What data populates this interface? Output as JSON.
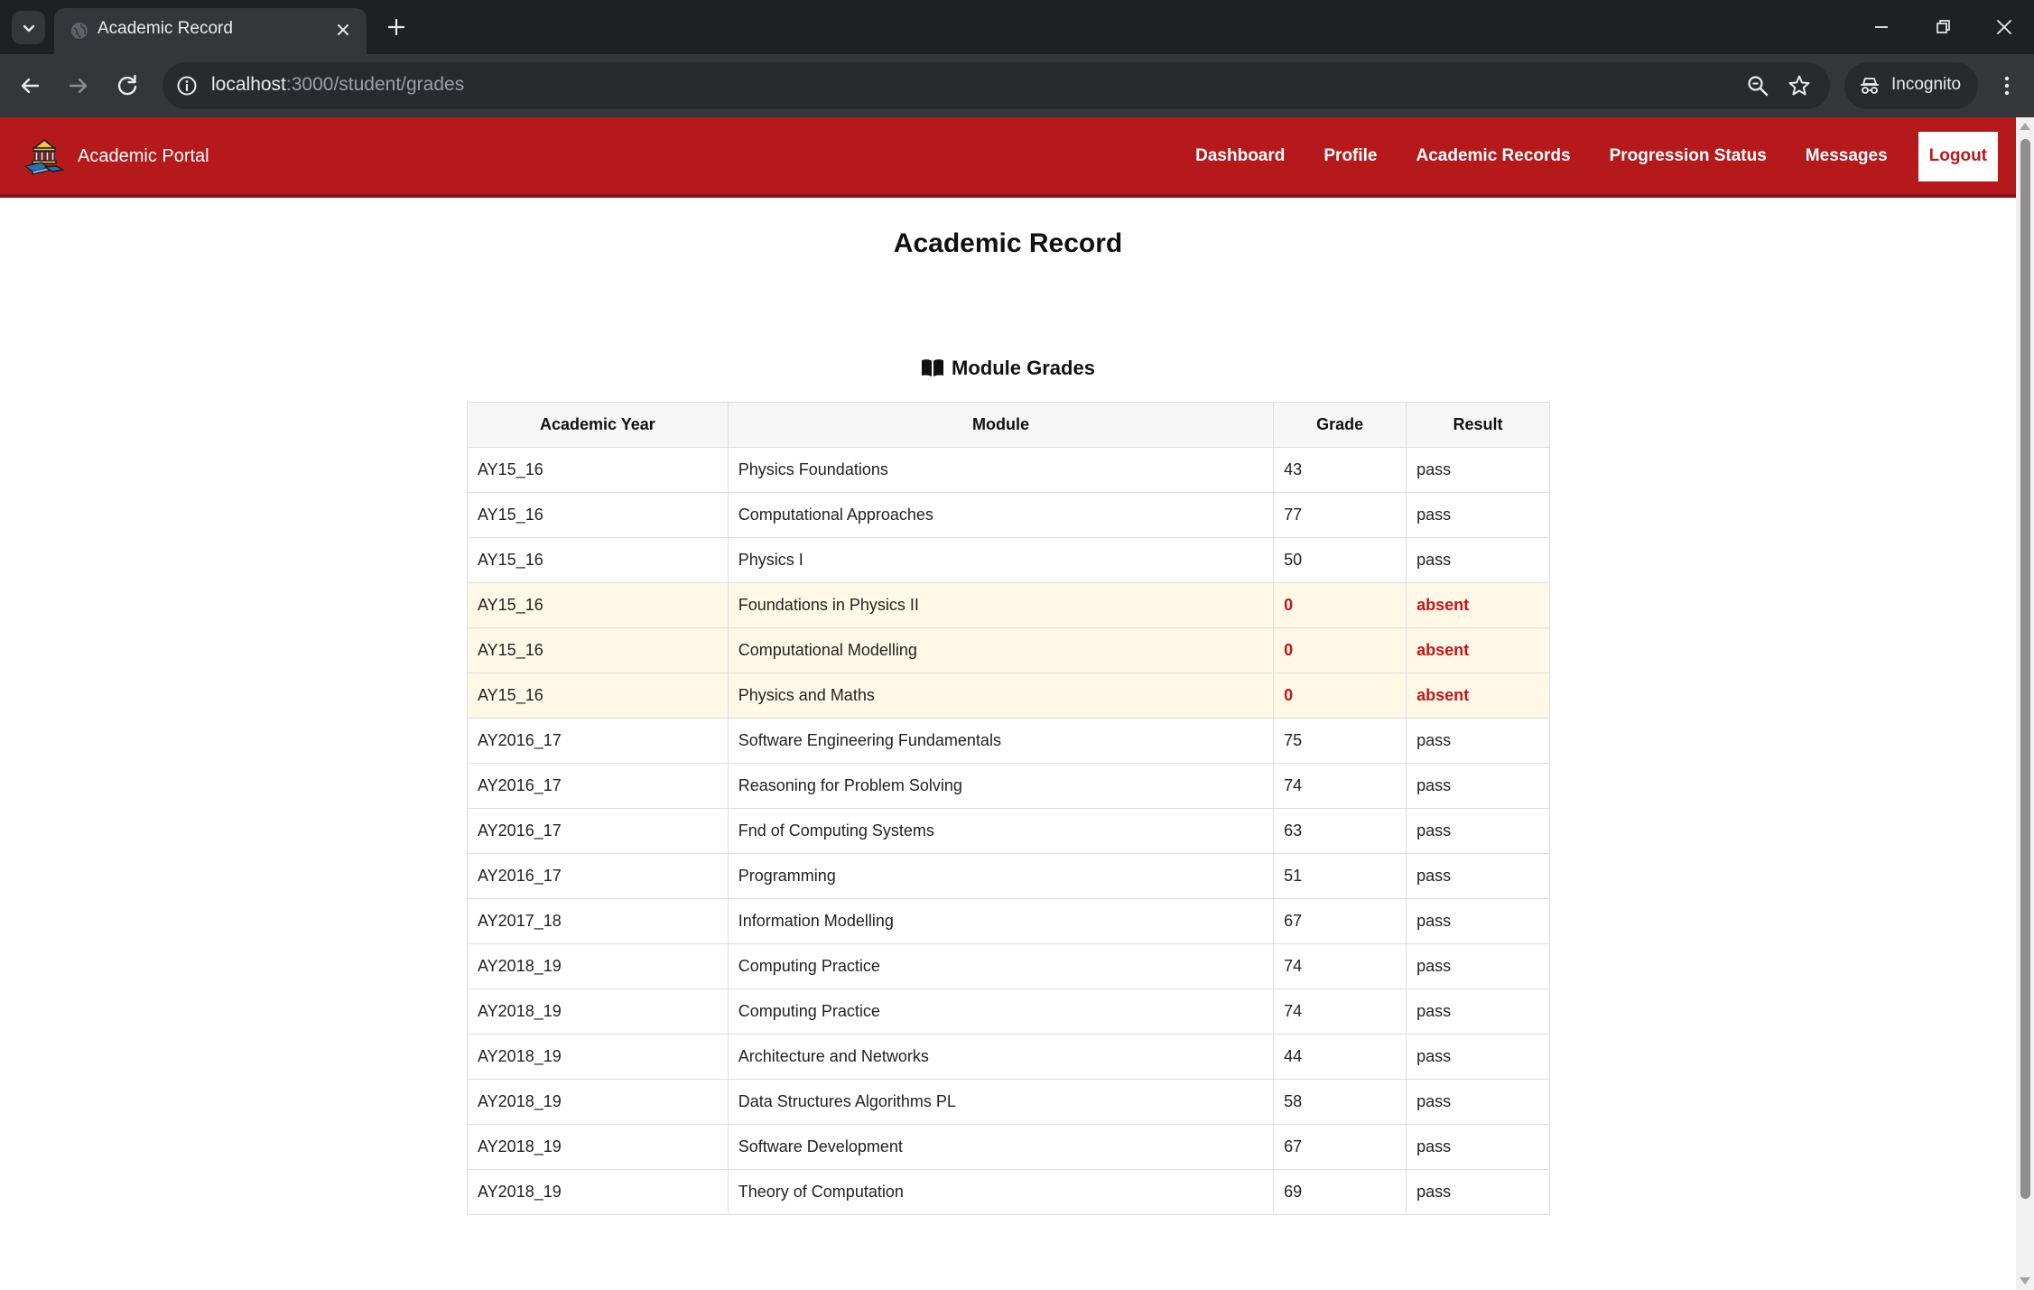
{
  "browser": {
    "tab_title": "Academic Record",
    "url_host": "localhost",
    "url_path": ":3000/student/grades",
    "incognito_label": "Incognito"
  },
  "navbar": {
    "brand": "Academic Portal",
    "links": [
      "Dashboard",
      "Profile",
      "Academic Records",
      "Progression Status",
      "Messages"
    ],
    "logout": "Logout",
    "color": "#b5191c"
  },
  "page": {
    "title": "Academic Record",
    "section_title": "Module Grades",
    "section_icon": "open-book-icon"
  },
  "table": {
    "headers": [
      "Academic Year",
      "Module",
      "Grade",
      "Result"
    ],
    "rows": [
      {
        "year": "AY15_16",
        "module": "Physics Foundations",
        "grade": "43",
        "result": "pass"
      },
      {
        "year": "AY15_16",
        "module": "Computational Approaches",
        "grade": "77",
        "result": "pass"
      },
      {
        "year": "AY15_16",
        "module": "Physics I",
        "grade": "50",
        "result": "pass"
      },
      {
        "year": "AY15_16",
        "module": "Foundations in Physics II",
        "grade": "0",
        "result": "absent"
      },
      {
        "year": "AY15_16",
        "module": "Computational Modelling",
        "grade": "0",
        "result": "absent"
      },
      {
        "year": "AY15_16",
        "module": "Physics and Maths",
        "grade": "0",
        "result": "absent"
      },
      {
        "year": "AY2016_17",
        "module": "Software Engineering Fundamentals",
        "grade": "75",
        "result": "pass"
      },
      {
        "year": "AY2016_17",
        "module": "Reasoning for Problem Solving",
        "grade": "74",
        "result": "pass"
      },
      {
        "year": "AY2016_17",
        "module": "Fnd of Computing Systems",
        "grade": "63",
        "result": "pass"
      },
      {
        "year": "AY2016_17",
        "module": "Programming",
        "grade": "51",
        "result": "pass"
      },
      {
        "year": "AY2017_18",
        "module": "Information Modelling",
        "grade": "67",
        "result": "pass"
      },
      {
        "year": "AY2018_19",
        "module": "Computing Practice",
        "grade": "74",
        "result": "pass"
      },
      {
        "year": "AY2018_19",
        "module": "Computing Practice",
        "grade": "74",
        "result": "pass"
      },
      {
        "year": "AY2018_19",
        "module": "Architecture and Networks",
        "grade": "44",
        "result": "pass"
      },
      {
        "year": "AY2018_19",
        "module": "Data Structures Algorithms PL",
        "grade": "58",
        "result": "pass"
      },
      {
        "year": "AY2018_19",
        "module": "Software Development",
        "grade": "67",
        "result": "pass"
      },
      {
        "year": "AY2018_19",
        "module": "Theory of Computation",
        "grade": "69",
        "result": "pass"
      }
    ]
  }
}
